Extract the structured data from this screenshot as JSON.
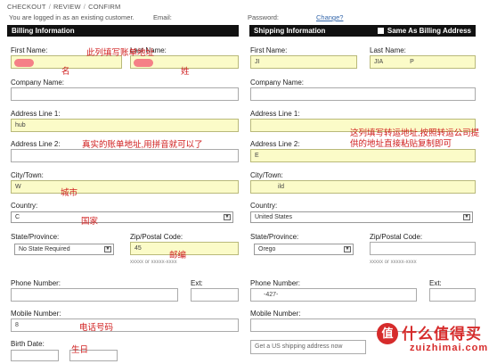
{
  "breadcrumb": {
    "step1": "CHECKOUT",
    "step2": "REVIEW",
    "step3": "CONFIRM",
    "sep": "/"
  },
  "account": {
    "logged_in_text": "You are logged in as an existing customer.",
    "email_label": "Email:",
    "password_label": "Password:",
    "change_link": "Change?"
  },
  "billing": {
    "header": "Billing Information",
    "first_name_label": "First Name:",
    "last_name_label": "Last Name:",
    "company_label": "Company Name:",
    "addr1_label": "Address Line 1:",
    "addr1_value": "hub",
    "addr2_label": "Address Line 2:",
    "city_label": "City/Town:",
    "city_value": "W",
    "country_label": "Country:",
    "country_value": "C",
    "state_label": "State/Province:",
    "state_value": "No State Required",
    "zip_label": "Zip/Postal Code:",
    "zip_value": "45",
    "zip_hint": "xxxxx or xxxxx-xxxx",
    "phone_label": "Phone Number:",
    "ext_label": "Ext:",
    "mobile_label": "Mobile Number:",
    "mobile_value": "8",
    "birth_label": "Birth Date:"
  },
  "shipping": {
    "header": "Shipping Information",
    "same_as_billing": "Same As Billing Address",
    "first_name_label": "First Name:",
    "first_name_value": "JI",
    "last_name_label": "Last Name:",
    "last_name_value": "JIA",
    "last_name_suffix": "P",
    "company_label": "Company Name:",
    "addr1_label": "Address Line 1:",
    "addr2_label": "Address Line 2:",
    "addr2_value": "E",
    "city_label": "City/Town:",
    "city_value": "ild",
    "country_label": "Country:",
    "country_value": "United States",
    "state_label": "State/Province:",
    "state_value": "Orego",
    "zip_label": "Zip/Postal Code:",
    "zip_hint": "xxxxx or xxxxx-xxxx",
    "phone_label": "Phone Number:",
    "phone_value": "-427-",
    "ext_label": "Ext:",
    "mobile_label": "Mobile Number:",
    "us_address_prompt": "Get a US shipping address now"
  },
  "annotations": {
    "col_name_note": "此列填写账单地址",
    "first_name_note": "名",
    "last_name_note": "姓",
    "address_note": "真实的账单地址,用拼音就可以了",
    "city_note": "城市",
    "country_note": "国家",
    "zip_note": "邮编",
    "phone_note": "电话号码",
    "birth_note": "生日",
    "shipping_note_1": "这列填写转运地址,按照转运公司提",
    "shipping_note_2": "供的地址直接粘贴复制即可"
  },
  "watermark": {
    "badge": "值",
    "main": "什么值得买",
    "sub": "zuizhimai.com"
  },
  "colors": {
    "highlight": "#fbfbc8",
    "header_bg": "#111111",
    "note_red": "#d02020",
    "logo_red": "#d62b2b"
  }
}
